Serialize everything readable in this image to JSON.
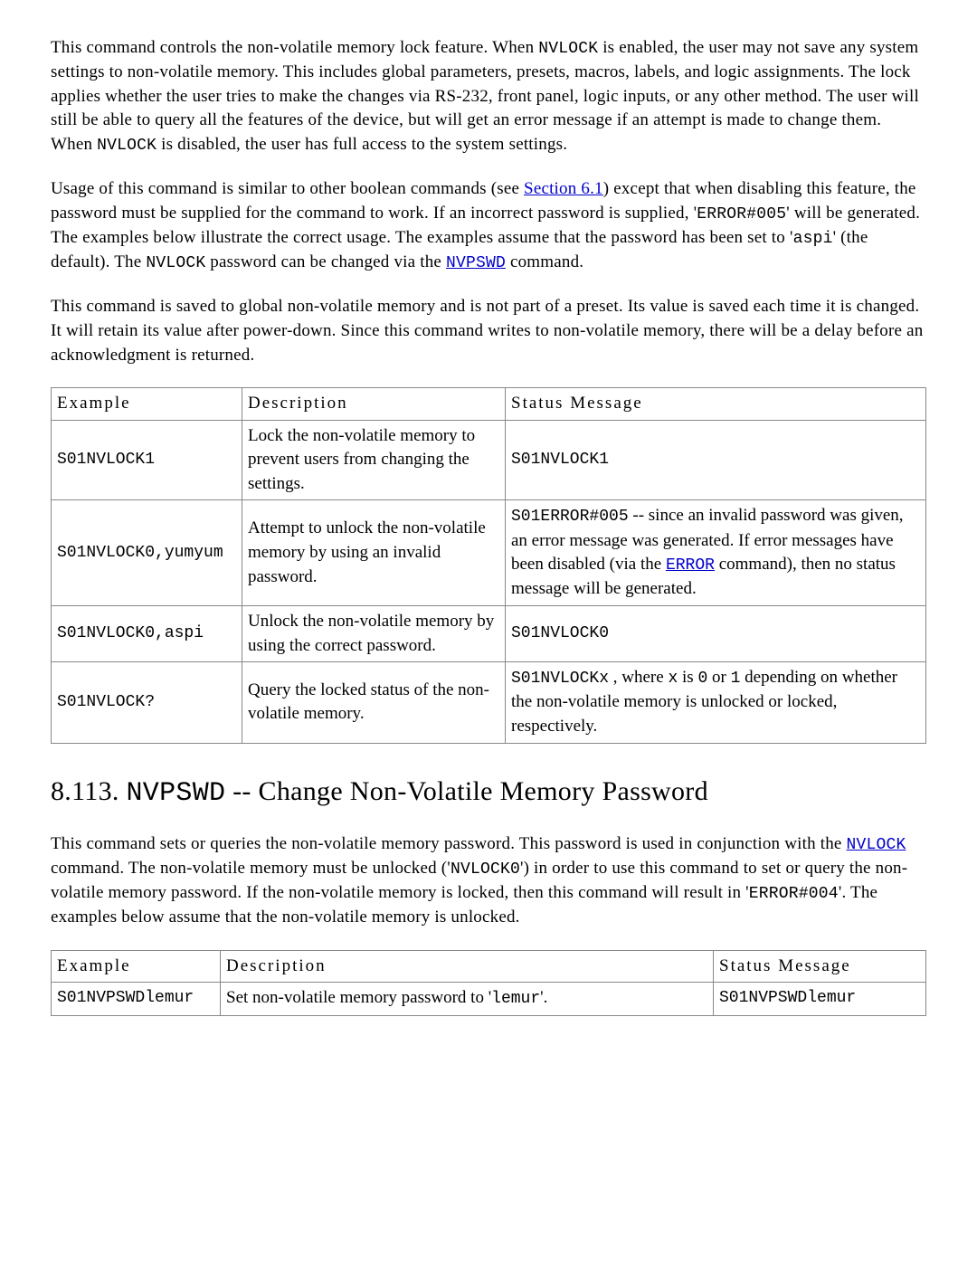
{
  "paragraphs": {
    "p1a": "This command controls the non-volatile memory lock feature. When ",
    "p1b": " is enabled, the user may not save any system settings to non-volatile memory. This includes global parameters, presets, macros, labels, and logic assignments. The lock applies whether the user tries to make the changes via RS-232, front panel, logic inputs, or any other method. The user will still be able to query all the features of the device, but will get an error message if an attempt is made to change them. When ",
    "p1c": " is disabled, the user has full access to the system settings.",
    "p1_code1": "NVLOCK",
    "p1_code2": "NVLOCK",
    "p2a": "Usage of this command is similar to other boolean commands (see ",
    "p2_link1": "Section 6.1",
    "p2b": ") except that when disabling this feature, the password must be supplied for the command to work. If an incorrect password is supplied, '",
    "p2_code1": "ERROR#005",
    "p2c": "' will be generated. The examples below illustrate the correct usage. The examples assume that the password has been set to '",
    "p2_code2": "aspi",
    "p2d": "' (the default). The ",
    "p2_code3": "NVLOCK",
    "p2e": " password can be changed via the ",
    "p2_link2": "NVPSWD",
    "p2f": " command.",
    "p3": "This command is saved to global non-volatile memory and is not part of a preset. Its value is saved each time it is changed. It will retain its value after power-down. Since this command writes to non-volatile memory, there will be a delay before an acknowledgment is returned."
  },
  "table1": {
    "headers": {
      "ex": "Example",
      "de": "Description",
      "st": "Status Message"
    },
    "rows": [
      {
        "ex": "S01NVLOCK1",
        "de": "Lock the non-volatile memory to prevent users from changing the settings.",
        "st": "S01NVLOCK1"
      },
      {
        "ex": "S01NVLOCK0,yumyum",
        "de": "Attempt to unlock the non-volatile memory by using an invalid password.",
        "st_code": "S01ERROR#005",
        "st_a": " -- since an invalid password was given, an error message was generated. If error messages have been disabled (via the ",
        "st_link": "ERROR",
        "st_b": " command), then no status message will be generated."
      },
      {
        "ex": "S01NVLOCK0,aspi",
        "de": "Unlock the non-volatile memory by using the correct password.",
        "st": "S01NVLOCK0"
      },
      {
        "ex": "S01NVLOCK?",
        "de": "Query the locked status of the non-volatile memory.",
        "st_code": "S01NVLOCKx",
        "st_a": " , where ",
        "st_code2": "x",
        "st_b": " is ",
        "st_code3": "0",
        "st_c": " or ",
        "st_code4": "1",
        "st_d": " depending on whether the non-volatile memory is unlocked or locked, respectively."
      }
    ]
  },
  "heading": {
    "num": "8.113. ",
    "code": "NVPSWD",
    "rest": " -- Change Non-Volatile Memory Password"
  },
  "paragraphs2": {
    "p1a": "This command sets or queries the non-volatile memory password. This password is used in conjunction with the ",
    "p1_link": "NVLOCK",
    "p1b": " command. The non-volatile memory must be unlocked ('",
    "p1_code1": "NVLOCK0",
    "p1c": "') in order to use this command to set or query the non-volatile memory password. If the non-volatile memory is locked, then this command will result in '",
    "p1_code2": "ERROR#004",
    "p1d": "'. The examples below assume that the non-volatile memory is unlocked."
  },
  "table2": {
    "headers": {
      "ex": "Example",
      "de": "Description",
      "st": "Status Message"
    },
    "rows": [
      {
        "ex": "S01NVPSWDlemur",
        "de_a": "Set non-volatile memory password to '",
        "de_code": "lemur",
        "de_b": "'.",
        "st": "S01NVPSWDlemur"
      }
    ]
  }
}
